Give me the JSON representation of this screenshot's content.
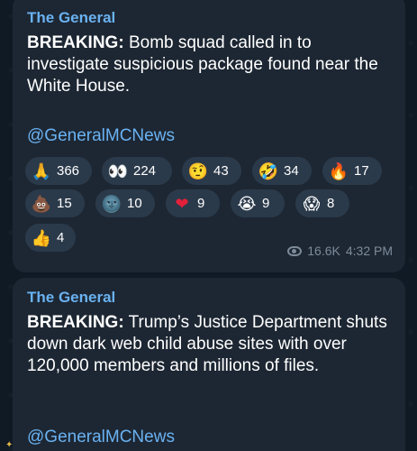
{
  "messages": [
    {
      "sender": "The General",
      "headline": "BREAKING:",
      "body": " Bomb squad called in to investigate suspicious package found near the White House.",
      "handle": "@GeneralMCNews",
      "reactions": [
        {
          "icon": "folded-hands",
          "glyph": "🙏",
          "count": "366"
        },
        {
          "icon": "eyes",
          "glyph": "👀",
          "count": "224"
        },
        {
          "icon": "raised-eyebrow-face",
          "glyph": "🤨",
          "count": "43"
        },
        {
          "icon": "rofl-face",
          "glyph": "🤣",
          "count": "34"
        },
        {
          "icon": "fire",
          "glyph": "🔥",
          "count": "17"
        },
        {
          "icon": "poop",
          "glyph": "💩",
          "count": "15"
        },
        {
          "icon": "new-moon-face",
          "glyph": "🌚",
          "count": "10"
        },
        {
          "icon": "red-heart",
          "glyph": "❤",
          "count": "9"
        },
        {
          "icon": "crying-face",
          "glyph": "😭",
          "count": "9"
        },
        {
          "icon": "screaming-face",
          "glyph": "😱",
          "count": "8"
        },
        {
          "icon": "thumbs-up",
          "glyph": "👍",
          "count": "4"
        }
      ],
      "views": "16.6K",
      "time": "4:32 PM"
    },
    {
      "sender": "The General",
      "headline": "BREAKING:",
      "body": " Trump’s Justice Department shuts down dark web child abuse sites with over 120,000 members and millions of files.",
      "handle": "@GeneralMCNews"
    }
  ],
  "colors": {
    "background": "#0f1a24",
    "bubble": "#1d2733",
    "accent": "#6ab2f2",
    "reaction_pill": "#2b3a4a",
    "meta_text": "#7d8b99"
  }
}
